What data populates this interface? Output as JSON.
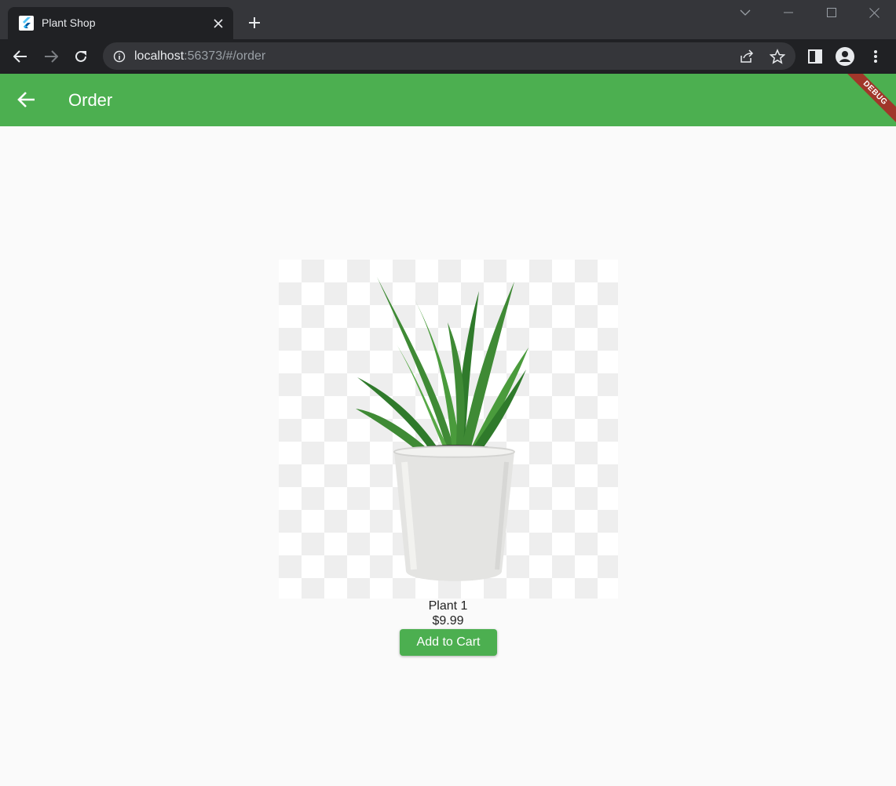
{
  "browser": {
    "tab": {
      "title": "Plant Shop",
      "favicon": "flutter-icon"
    },
    "url": {
      "host": "localhost",
      "rest": ":56373/#/order"
    }
  },
  "appbar": {
    "title": "Order",
    "debug_banner": "DEBUG",
    "back_icon": "arrow-back-icon"
  },
  "product": {
    "name": "Plant 1",
    "price": "$9.99",
    "image": "plant-pot-image"
  },
  "actions": {
    "add_to_cart_label": "Add to Cart"
  },
  "colors": {
    "primary": "#4caf50",
    "debug": "#a1362a"
  }
}
